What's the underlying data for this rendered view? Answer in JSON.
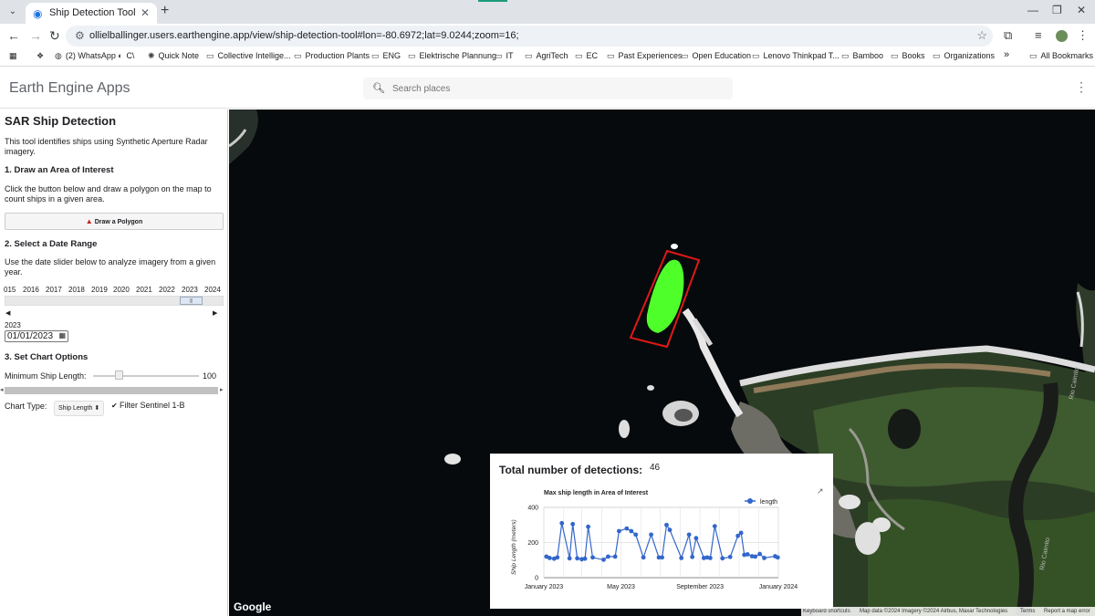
{
  "browser": {
    "tab_title": "Ship Detection Tool",
    "url": "ollielballinger.users.earthengine.app/view/ship-detection-tool#lon=-80.6972;lat=9.0244;zoom=16;",
    "bookmarks": [
      {
        "label": "",
        "icon": "dropbox-icon"
      },
      {
        "label": "(2) WhatsApp",
        "icon": "whatsapp-icon"
      },
      {
        "label": "C\\",
        "icon": "globe-icon"
      },
      {
        "label": "Quick Note",
        "icon": "gear-icon"
      },
      {
        "label": "Collective Intellige...",
        "icon": "folder-icon"
      },
      {
        "label": "Production Plants",
        "icon": "folder-icon"
      },
      {
        "label": "ENG",
        "icon": "folder-icon"
      },
      {
        "label": "Elektrische Plannung",
        "icon": "folder-icon"
      },
      {
        "label": "IT",
        "icon": "folder-icon"
      },
      {
        "label": "AgriTech",
        "icon": "folder-icon"
      },
      {
        "label": "EC",
        "icon": "folder-icon"
      },
      {
        "label": "Past Experiences",
        "icon": "folder-icon"
      },
      {
        "label": "Open Education",
        "icon": "folder-icon"
      },
      {
        "label": "Lenovo Thinkpad T...",
        "icon": "folder-icon"
      },
      {
        "label": "Bamboo",
        "icon": "folder-icon"
      },
      {
        "label": "Books",
        "icon": "folder-icon"
      },
      {
        "label": "Organizations",
        "icon": "folder-icon"
      }
    ],
    "more_bookmarks": "»",
    "all_bookmarks": "All Bookmarks"
  },
  "app": {
    "brand": "Earth Engine Apps",
    "search_placeholder": "Search places"
  },
  "panel": {
    "title": "SAR Ship Detection",
    "intro": "This tool identifies ships using Synthetic Aperture Radar imagery.",
    "step1_title": "1. Draw an Area of Interest",
    "step1_text": "Click the button below and draw a polygon on the map to count ships in a given area.",
    "draw_button": "Draw a Polygon",
    "step2_title": "2. Select a Date Range",
    "step2_text": "Use the date slider below to analyze imagery from a given year.",
    "years": [
      "015",
      "2016",
      "2017",
      "2018",
      "2019",
      "2020",
      "2021",
      "2022",
      "2023",
      "2024"
    ],
    "year_thumb": "|||",
    "selected_year": "2023",
    "date_value": "01/01/2023",
    "step3_title": "3. Set Chart Options",
    "min_length_label": "Minimum Ship Length:",
    "min_length_value": "100",
    "min_length_fraction": 0.24,
    "chart_type_label": "Chart Type:",
    "chart_type_value": "Ship Length",
    "filter_label": "Filter Sentinel 1-B",
    "filter_checked": true
  },
  "map": {
    "google_logo": "Google",
    "attribution": [
      "Keyboard shortcuts",
      "Map data ©2024 Imagery ©2024 Airbus, Maxar Technologies",
      "Terms",
      "Report a map error"
    ],
    "river_labels": [
      "Rio Caimito",
      "Rio Caimito"
    ]
  },
  "card": {
    "title": "Total number of detections:",
    "count": "46",
    "chart_data": {
      "type": "line",
      "title": "Max ship length in Area of Interest",
      "ylabel": "Ship Length (meters)",
      "xlabel": "",
      "legend": "length",
      "legend_position": "top-right",
      "ylim": [
        0,
        400
      ],
      "yticks": [
        0,
        200,
        400
      ],
      "xlim": [
        "2023-01-01",
        "2024-01-01"
      ],
      "xticks": [
        {
          "date": "2023-01-01",
          "label": "January 2023"
        },
        {
          "date": "2023-05-01",
          "label": "May 2023"
        },
        {
          "date": "2023-09-01",
          "label": "September 2023"
        },
        {
          "date": "2024-01-01",
          "label": "January 2024"
        }
      ],
      "series": [
        {
          "name": "length",
          "color": "#3366cc",
          "points": [
            [
              "2023-01-05",
              120
            ],
            [
              "2023-01-10",
              112
            ],
            [
              "2023-01-17",
              108
            ],
            [
              "2023-01-22",
              115
            ],
            [
              "2023-01-29",
              310
            ],
            [
              "2023-02-10",
              110
            ],
            [
              "2023-02-15",
              305
            ],
            [
              "2023-02-22",
              110
            ],
            [
              "2023-03-01",
              105
            ],
            [
              "2023-03-06",
              108
            ],
            [
              "2023-03-11",
              290
            ],
            [
              "2023-03-18",
              115
            ],
            [
              "2023-04-04",
              102
            ],
            [
              "2023-04-11",
              120
            ],
            [
              "2023-04-22",
              120
            ],
            [
              "2023-04-28",
              265
            ],
            [
              "2023-05-10",
              280
            ],
            [
              "2023-05-17",
              265
            ],
            [
              "2023-05-24",
              245
            ],
            [
              "2023-06-05",
              115
            ],
            [
              "2023-06-17",
              245
            ],
            [
              "2023-06-29",
              115
            ],
            [
              "2023-07-04",
              115
            ],
            [
              "2023-07-11",
              300
            ],
            [
              "2023-07-16",
              272
            ],
            [
              "2023-08-03",
              112
            ],
            [
              "2023-08-15",
              245
            ],
            [
              "2023-08-20",
              118
            ],
            [
              "2023-08-26",
              225
            ],
            [
              "2023-09-07",
              112
            ],
            [
              "2023-09-12",
              115
            ],
            [
              "2023-09-17",
              112
            ],
            [
              "2023-09-24",
              293
            ],
            [
              "2023-10-06",
              110
            ],
            [
              "2023-10-18",
              118
            ],
            [
              "2023-10-30",
              238
            ],
            [
              "2023-11-04",
              255
            ],
            [
              "2023-11-09",
              130
            ],
            [
              "2023-11-14",
              133
            ],
            [
              "2023-11-21",
              122
            ],
            [
              "2023-11-26",
              120
            ],
            [
              "2023-12-03",
              135
            ],
            [
              "2023-12-10",
              112
            ],
            [
              "2023-12-27",
              122
            ],
            [
              "2023-12-31",
              115
            ]
          ]
        }
      ]
    }
  }
}
